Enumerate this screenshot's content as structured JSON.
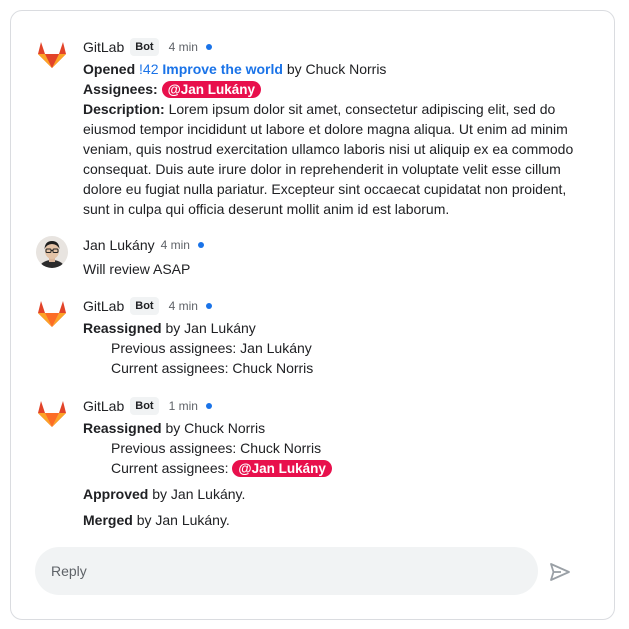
{
  "messages": [
    {
      "sender": "GitLab",
      "badge": "Bot",
      "time": "4 min",
      "opened_label": "Opened",
      "mr_number": "!42",
      "mr_title": "Improve the world",
      "opened_by": "by Chuck Norris",
      "assignees_label": "Assignees:",
      "assignee_mention": "@Jan Lukány",
      "description_label": "Description:",
      "description_lines": [
        "Lorem ipsum dolor sit amet, consectetur adipiscing elit, sed do",
        "eiusmod tempor incididunt ut labore et dolore magna aliqua. Ut enim ad minim",
        "veniam, quis nostrud exercitation ullamco laboris nisi ut aliquip ex ea commodo",
        "consequat. Duis aute irure dolor in reprehenderit in voluptate velit esse cillum",
        "dolore eu fugiat nulla pariatur. Excepteur sint occaecat cupidatat non proident,",
        "sunt in culpa qui officia deserunt mollit anim id est laborum."
      ]
    },
    {
      "sender": "Jan Lukány",
      "time": "4 min",
      "text": "Will review ASAP"
    },
    {
      "sender": "GitLab",
      "badge": "Bot",
      "time": "4 min",
      "action_label": "Reassigned",
      "action_by": "by Jan Lukány",
      "previous": "Previous assignees: Jan Lukány",
      "current": "Current assignees: Chuck Norris"
    },
    {
      "sender": "GitLab",
      "badge": "Bot",
      "time": "1 min",
      "action_label": "Reassigned",
      "action_by": "by Chuck Norris",
      "previous": "Previous assignees: Chuck Norris",
      "current_label": "Current assignees:",
      "current_mention": "@Jan Lukány",
      "approved_label": "Approved",
      "approved_by": "by Jan Lukány.",
      "merged_label": "Merged",
      "merged_by": "by Jan Lukány."
    }
  ],
  "reply": {
    "placeholder": "Reply"
  },
  "colors": {
    "accent": "#1a73e8",
    "mention": "#e8104c",
    "unread_dot": "#1a73e8"
  },
  "icons": {
    "bot_avatar": "gitlab-logo-icon",
    "user_avatar": "user-avatar",
    "send": "send-icon"
  }
}
